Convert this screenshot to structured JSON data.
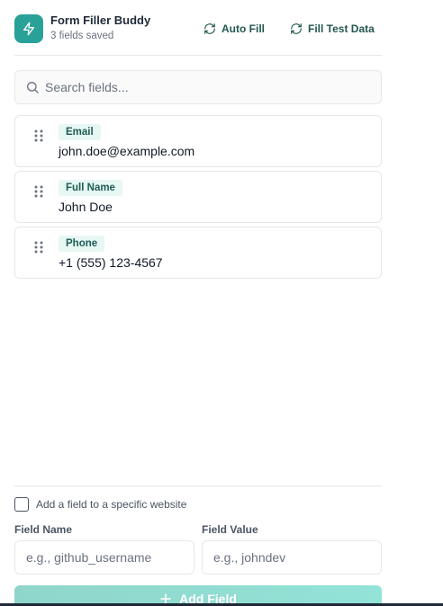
{
  "header": {
    "title": "Form Filler Buddy",
    "subtitle": "3 fields saved",
    "logo_icon": "bolt-icon",
    "auto_fill_label": "Auto Fill",
    "fill_test_label": "Fill Test Data"
  },
  "search": {
    "placeholder": "Search fields...",
    "value": ""
  },
  "fields": [
    {
      "name": "Email",
      "value": "john.doe@example.com"
    },
    {
      "name": "Full Name",
      "value": "John Doe"
    },
    {
      "name": "Phone",
      "value": "+1 (555) 123-4567"
    }
  ],
  "add_form": {
    "site_checkbox_label": "Add a field to a specific website",
    "site_checkbox_checked": false,
    "field_name_label": "Field Name",
    "field_name_placeholder": "e.g., github_username",
    "field_value_label": "Field Value",
    "field_value_placeholder": "e.g., johndev",
    "add_button_label": "Add Field"
  },
  "colors": {
    "accent": "#2aa198",
    "badge_bg": "#e6f7f4",
    "badge_text": "#1e5c53",
    "button_gradient_start": "#8fd5cb",
    "button_gradient_end": "#93e3d8"
  }
}
